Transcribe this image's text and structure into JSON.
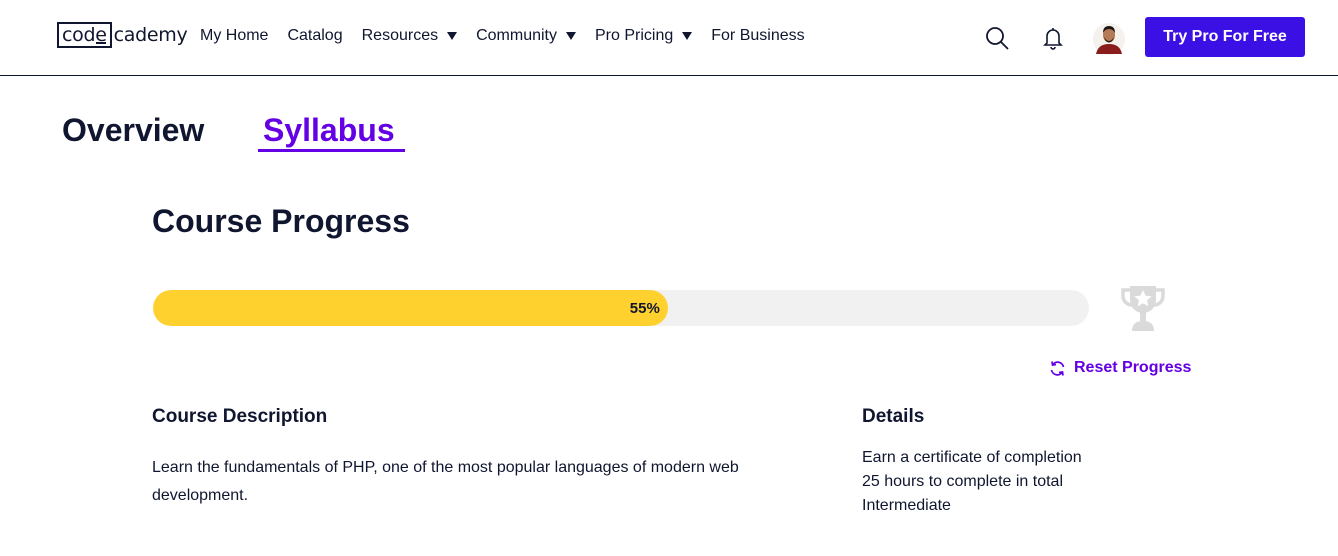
{
  "header": {
    "logo": {
      "boxed": "code",
      "rest": "cademy"
    },
    "nav": [
      {
        "label": "My Home",
        "dropdown": false
      },
      {
        "label": "Catalog",
        "dropdown": false
      },
      {
        "label": "Resources",
        "dropdown": true
      },
      {
        "label": "Community",
        "dropdown": true
      },
      {
        "label": "Pro Pricing",
        "dropdown": true
      },
      {
        "label": "For Business",
        "dropdown": false
      }
    ],
    "icons": [
      "search-icon",
      "bell-icon",
      "avatar"
    ],
    "cta_label": "Try Pro For Free",
    "cta_color": "#3a10e5"
  },
  "tabs": [
    {
      "label": "Overview",
      "active": false
    },
    {
      "label": "Syllabus",
      "active": true
    }
  ],
  "progress": {
    "title": "Course Progress",
    "percent": 55,
    "percent_label": "55%",
    "fill_color": "#ffd12f",
    "reset_label": "Reset Progress"
  },
  "description": {
    "title": "Course Description",
    "text": "Learn the fundamentals of PHP, one of the most popular languages of modern web development."
  },
  "details": {
    "title": "Details",
    "items": [
      "Earn a certificate of completion",
      "25 hours to complete in total",
      "Intermediate"
    ]
  },
  "colors": {
    "accent": "#6400e4",
    "text": "#10162f"
  }
}
